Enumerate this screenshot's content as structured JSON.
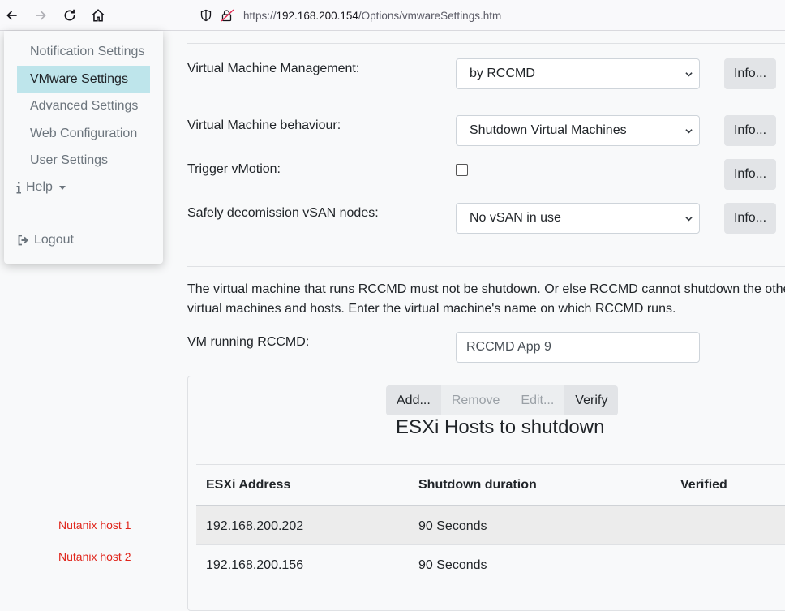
{
  "browser": {
    "url_prefix": "https://",
    "url_host": "192.168.200.154",
    "url_path": "/Options/vmwareSettings.htm"
  },
  "menu": {
    "items": [
      {
        "label": "Notification Settings",
        "active": false
      },
      {
        "label": "VMware Settings",
        "active": true
      },
      {
        "label": "Advanced Settings",
        "active": false
      },
      {
        "label": "Web Configuration",
        "active": false
      },
      {
        "label": "User Settings",
        "active": false
      }
    ],
    "help_label": "Help",
    "logout_label": "Logout"
  },
  "annotations": [
    "Nutanix host 1",
    "Nutanix host 2"
  ],
  "form": {
    "vm_management": {
      "label": "Virtual Machine Management:",
      "value": "by RCCMD"
    },
    "vm_behaviour": {
      "label": "Virtual Machine behaviour:",
      "value": "Shutdown Virtual Machines"
    },
    "trigger_vmotion": {
      "label": "Trigger vMotion:",
      "checked": false
    },
    "vsan": {
      "label": "Safely decomission vSAN nodes:",
      "value": "No vSAN in use"
    },
    "info_label": "Info...",
    "description_line1": "The virtual machine that runs RCCMD must not be shutdown. Or else RCCMD cannot shutdown the other",
    "description_line2": "virtual machines and hosts. Enter the virtual machine's name on which RCCMD runs.",
    "vm_running": {
      "label": "VM running RCCMD:",
      "value": "RCCMD App 9"
    }
  },
  "hosts": {
    "buttons": {
      "add": "Add...",
      "remove": "Remove",
      "edit": "Edit...",
      "verify": "Verify"
    },
    "title": "ESXi Hosts to shutdown",
    "columns": [
      "ESXi Address",
      "Shutdown duration",
      "Verified"
    ],
    "rows": [
      {
        "address": "192.168.200.202",
        "duration": "90 Seconds",
        "verified": ""
      },
      {
        "address": "192.168.200.156",
        "duration": "90 Seconds",
        "verified": ""
      }
    ]
  },
  "colors": {
    "active_menu_bg": "#bee5eb",
    "annotation_red": "#e0251b",
    "button_bg": "#e2e4e7"
  }
}
